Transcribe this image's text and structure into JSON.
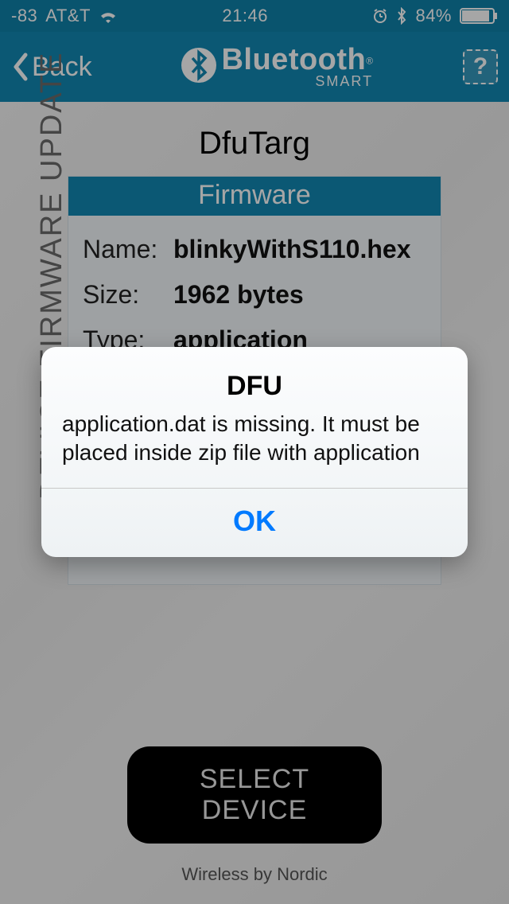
{
  "status": {
    "signal": "-83",
    "carrier": "AT&T",
    "time": "21:46",
    "battery_pct": "84%"
  },
  "nav": {
    "back_label": "Back",
    "title_word": "Bluetooth",
    "title_tm": "®",
    "title_smart": "SMART",
    "help_glyph": "?"
  },
  "page": {
    "title": "DfuTarg",
    "side_label": "DEVICE FIRMWARE UPDATE",
    "select_button": "SELECT DEVICE",
    "footer": "Wireless by Nordic"
  },
  "firmware": {
    "header": "Firmware",
    "name_label": "Name:",
    "name_value": "blinkyWithS110.hex",
    "size_label": "Size:",
    "size_value": "1962 bytes",
    "type_label": "Type:",
    "type_value": "application"
  },
  "alert": {
    "title": "DFU",
    "message": "application.dat is missing. It must be placed inside zip file with application",
    "ok": "OK"
  }
}
